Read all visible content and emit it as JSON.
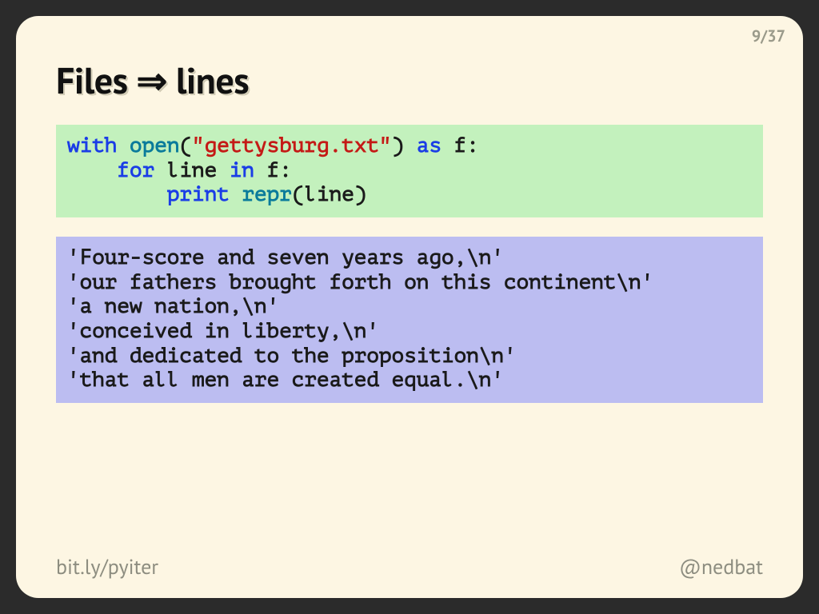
{
  "page": {
    "current": 9,
    "total": 37,
    "counter": "9/37"
  },
  "title": "Files ⇒ lines",
  "code": {
    "tokens": [
      {
        "t": "with",
        "c": "kw"
      },
      {
        "t": " "
      },
      {
        "t": "open",
        "c": "fn"
      },
      {
        "t": "("
      },
      {
        "t": "\"gettysburg.txt\"",
        "c": "str"
      },
      {
        "t": ") "
      },
      {
        "t": "as",
        "c": "kw"
      },
      {
        "t": " f:\n    "
      },
      {
        "t": "for",
        "c": "kw"
      },
      {
        "t": " line "
      },
      {
        "t": "in",
        "c": "kw"
      },
      {
        "t": " f:\n        "
      },
      {
        "t": "print",
        "c": "kw"
      },
      {
        "t": " "
      },
      {
        "t": "repr",
        "c": "fn"
      },
      {
        "t": "(line)"
      }
    ]
  },
  "output_lines": [
    "'Four-score and seven years ago,\\n'",
    "'our fathers brought forth on this continent\\n'",
    "'a new nation,\\n'",
    "'conceived in liberty,\\n'",
    "'and dedicated to the proposition\\n'",
    "'that all men are created equal.\\n'"
  ],
  "footer": {
    "left": "bit.ly/pyiter",
    "right": "@nedbat"
  },
  "colors": {
    "slide_bg": "#fdf6e3",
    "code_bg": "#c3f1bd",
    "output_bg": "#bcbdf1",
    "keyword": "#1a3de6",
    "function": "#0a7b9b",
    "string": "#c41a16"
  }
}
